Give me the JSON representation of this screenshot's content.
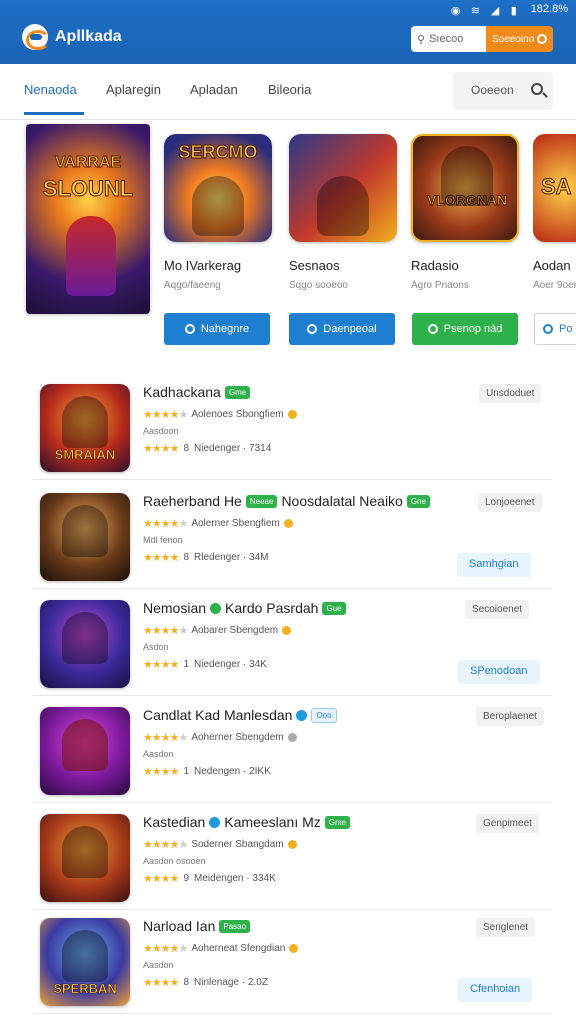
{
  "status_bar": {
    "time": "182.8%",
    "icons": [
      "vpn-icon",
      "wifi-icon",
      "signal-icon",
      "battery-icon"
    ]
  },
  "header": {
    "brand": "Apllkada",
    "search_placeholder": "Sıecoo",
    "search_button": "Soeeoino"
  },
  "tabs": [
    {
      "label": "Nenaoda",
      "active": true
    },
    {
      "label": "Aplaregin",
      "active": false
    },
    {
      "label": "Apladan",
      "active": false
    },
    {
      "label": "Bileoria",
      "active": false
    }
  ],
  "tab_search": {
    "label": "Ooeeon"
  },
  "hero": {
    "line1": "VARRAE",
    "line2": "SLOUNL"
  },
  "featured": [
    {
      "art_text": "SERCMO",
      "name": "Mo IVarkerag",
      "sub": "Aqgo/faeeng",
      "button": "Nahegnre",
      "style": "blue"
    },
    {
      "art_text": "",
      "name": "Sesnaos",
      "sub": "Sqgo sooeoo",
      "button": "Daenpeoal",
      "style": "blue"
    },
    {
      "art_text": "VLORGNAN",
      "name": "Radasio",
      "sub": "Agro Pnaons",
      "button": "Psenop nád",
      "style": "green"
    },
    {
      "art_text": "SA",
      "name": "Aodan",
      "sub": "Aoer 9oer",
      "button": "Po",
      "style": "outline"
    }
  ],
  "apps": [
    {
      "title": "Kadhackana",
      "badge": "Gme",
      "badge_style": "green",
      "verified": "",
      "rating_text": "Aolenoes Sbongfiem",
      "sub": "Aasdoon",
      "stars2": "8",
      "meta": "Niedenger · 7314",
      "tag": "Unsdoduet",
      "action": "",
      "art": "SMRAIAN"
    },
    {
      "title": "Raeherband He",
      "badge": "Neeae",
      "badge_style": "green",
      "extra": "Noosdalatal Neaiko",
      "badge2": "Gne",
      "verified": "",
      "rating_text": "Aolerner Sbengfiem",
      "sub": "Mdl fenon",
      "stars2": "8",
      "meta": "Rledenger · 34M",
      "tag": "Lonjoeenet",
      "action": "Samhgian",
      "art": ""
    },
    {
      "title": "Nemosian",
      "badge": "Gue",
      "badge_style": "green",
      "verified": "green",
      "extra": "Kardo Pasrdah",
      "rating_text": "Aobarer Sbengdem",
      "sub": "Asdon",
      "stars2": "1",
      "meta": "Niedenger · 34K",
      "tag": "Secoioenet",
      "action": "SPenodoan",
      "art": ""
    },
    {
      "title": "Candlat Kad Manlesdan",
      "badge": "Ooo",
      "badge_style": "blue",
      "verified": "blue",
      "rating_text": "Aoherner Sbengdem",
      "sub": "Aasdon",
      "stars2": "1",
      "meta": "Nedengen · 2IKK",
      "tag": "Beroplaenet",
      "action": "",
      "art": ""
    },
    {
      "title": "Kastedian",
      "badge": "Gme",
      "badge_style": "green",
      "verified": "blue",
      "extra": "Kameeslanı Mz",
      "rating_text": "Soderner Sbangdam",
      "sub": "Aasdon osooen",
      "stars2": "9",
      "meta": "Meidengen · 334K",
      "tag": "Genpimeet",
      "action": "",
      "art": ""
    },
    {
      "title": "Narload Ian",
      "badge": "Pasao",
      "badge_style": "green",
      "verified": "",
      "rating_text": "Aoherneat Sfengdian",
      "sub": "Aasdon",
      "stars2": "8",
      "meta": "Ninlenage · 2.0Z",
      "tag": "Senglenet",
      "action": "Cfenhoian",
      "art": "SPERBAN"
    }
  ]
}
